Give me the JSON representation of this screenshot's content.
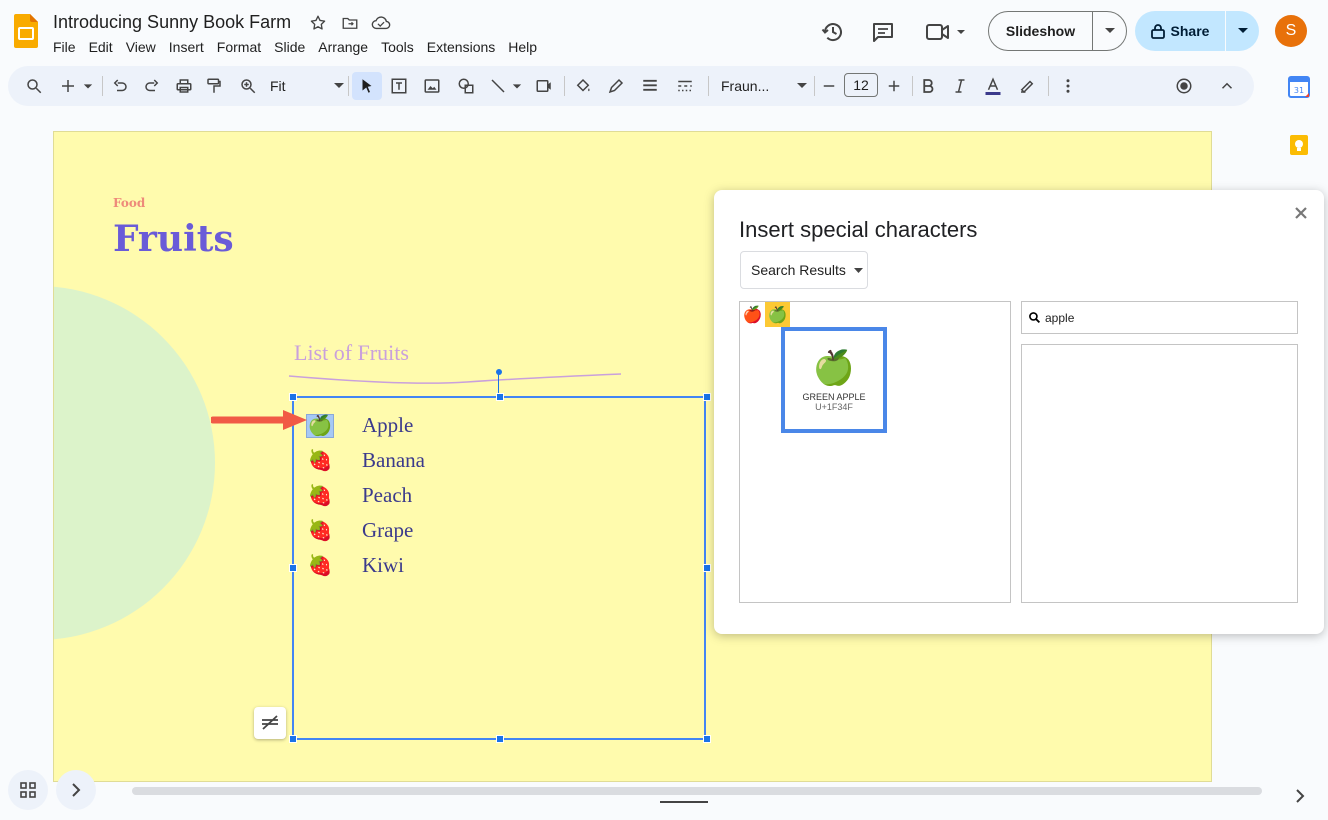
{
  "header": {
    "doc_title": "Introducing Sunny Book Farm",
    "menu": [
      "File",
      "Edit",
      "View",
      "Insert",
      "Format",
      "Slide",
      "Arrange",
      "Tools",
      "Extensions",
      "Help"
    ],
    "slideshow_label": "Slideshow",
    "share_label": "Share",
    "avatar_initial": "S"
  },
  "toolbar": {
    "zoom": "Fit",
    "font": "Fraun...",
    "font_size": "12",
    "colors": {
      "accent": "#1a73e8",
      "toolbar_bg": "#edf2fa",
      "share_bg": "#c2e7ff"
    }
  },
  "slide": {
    "category": "Food",
    "heading": "Fruits",
    "list_subtitle": "List of Fruits",
    "fruits": [
      {
        "emoji": "🍏",
        "name": "Apple",
        "selected": true
      },
      {
        "emoji": "🍓",
        "name": "Banana",
        "selected": false
      },
      {
        "emoji": "🍓",
        "name": "Peach",
        "selected": false
      },
      {
        "emoji": "🍓",
        "name": "Grape",
        "selected": false
      },
      {
        "emoji": "🍓",
        "name": "Kiwi",
        "selected": false
      }
    ],
    "colors": {
      "background": "#fffbad",
      "heading": "#6a5bd8",
      "category": "#ee8a7a",
      "list_text": "#3b3a8c"
    }
  },
  "dialog": {
    "title": "Insert special characters",
    "category": "Search Results",
    "results": [
      "🍎",
      "🍏"
    ],
    "preview": {
      "emoji": "🍏",
      "name": "GREEN APPLE",
      "code": "U+1F34F"
    },
    "search_value": "apple"
  }
}
